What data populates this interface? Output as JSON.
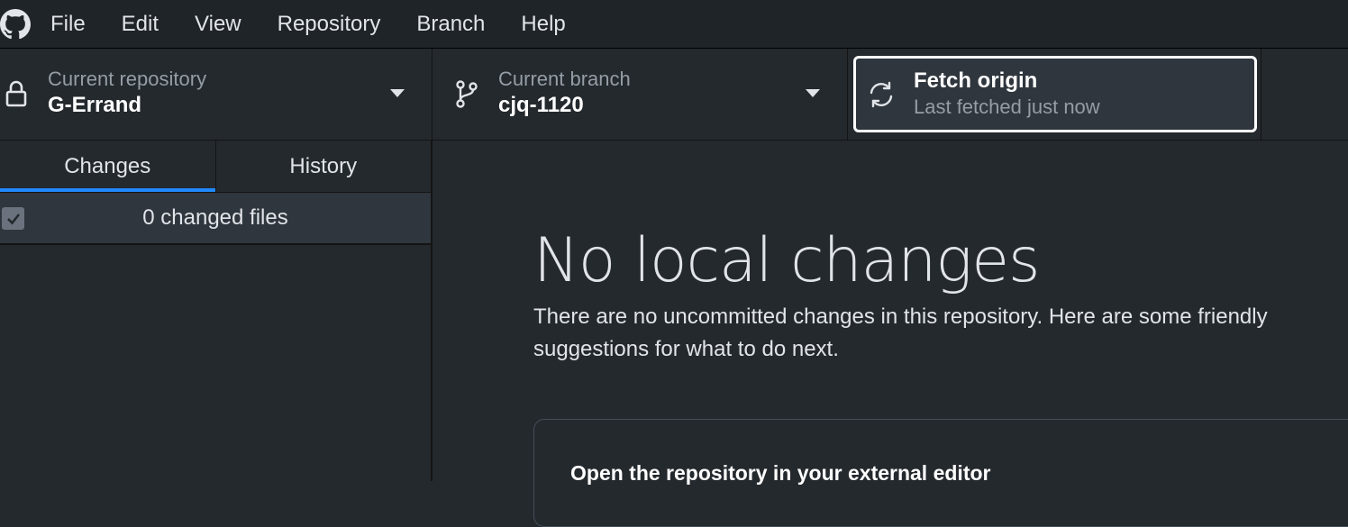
{
  "menu": {
    "logo_icon": "github-mark-icon",
    "items": [
      "File",
      "Edit",
      "View",
      "Repository",
      "Branch",
      "Help"
    ]
  },
  "toolbar": {
    "repository": {
      "icon": "lock-icon",
      "description": "Current repository",
      "title": "G-Errand"
    },
    "branch": {
      "icon": "git-branch-icon",
      "description": "Current branch",
      "title": "cjq-1120"
    },
    "fetch": {
      "icon": "sync-icon",
      "title": "Fetch origin",
      "description": "Last fetched just now"
    }
  },
  "sidebar": {
    "tabs": [
      {
        "label": "Changes",
        "active": true
      },
      {
        "label": "History",
        "active": false
      }
    ],
    "changes_label": "0 changed files"
  },
  "main": {
    "title": "No local changes",
    "description": "There are no uncommitted changes in this repository. Here are some friendly suggestions for what to do next.",
    "suggestion_title": "Open the repository in your external editor"
  },
  "colors": {
    "accent": "#2188ff",
    "background": "#24292e",
    "menubar": "#1f2428"
  }
}
